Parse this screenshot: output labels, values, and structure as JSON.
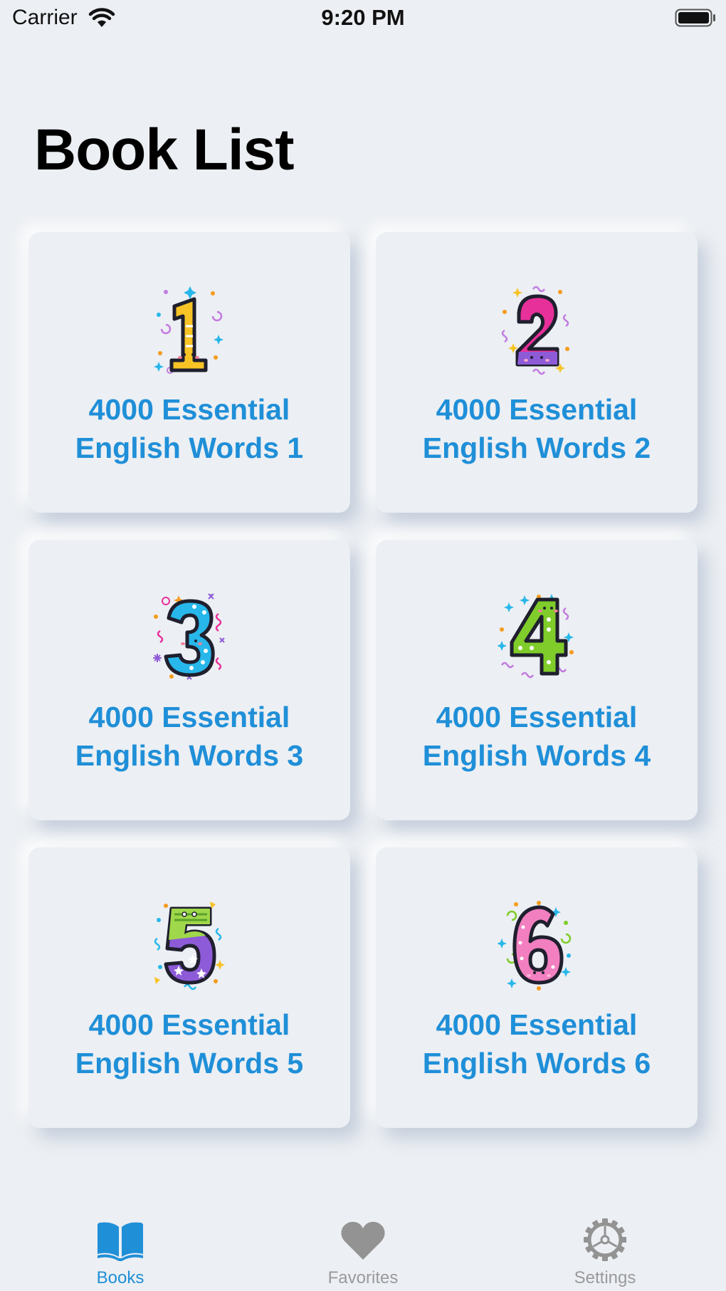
{
  "status_bar": {
    "carrier": "Carrier",
    "time": "9:20 PM"
  },
  "page": {
    "title": "Book List"
  },
  "books": [
    {
      "title_line1": "4000 Essential",
      "title_line2": "English Words 1",
      "numeral": "1",
      "numeral_color": "#f7c325"
    },
    {
      "title_line1": "4000 Essential",
      "title_line2": "English Words 2",
      "numeral": "2",
      "numeral_color": "#e8309a"
    },
    {
      "title_line1": "4000 Essential",
      "title_line2": "English Words 3",
      "numeral": "3",
      "numeral_color": "#27b7ea"
    },
    {
      "title_line1": "4000 Essential",
      "title_line2": "English Words 4",
      "numeral": "4",
      "numeral_color": "#7fcc2a"
    },
    {
      "title_line1": "4000 Essential",
      "title_line2": "English Words 5",
      "numeral": "5",
      "numeral_color": "#9a66e0"
    },
    {
      "title_line1": "4000 Essential",
      "title_line2": "English Words 6",
      "numeral": "6",
      "numeral_color": "#f27fc0"
    }
  ],
  "tab_bar": {
    "items": [
      {
        "label": "Books",
        "icon": "book-icon",
        "active": true
      },
      {
        "label": "Favorites",
        "icon": "heart-icon",
        "active": false
      },
      {
        "label": "Settings",
        "icon": "gear-icon",
        "active": false
      }
    ]
  },
  "colors": {
    "accent": "#1f8fd8",
    "background": "#eceff3",
    "inactive_tab": "#9a9a9c"
  }
}
